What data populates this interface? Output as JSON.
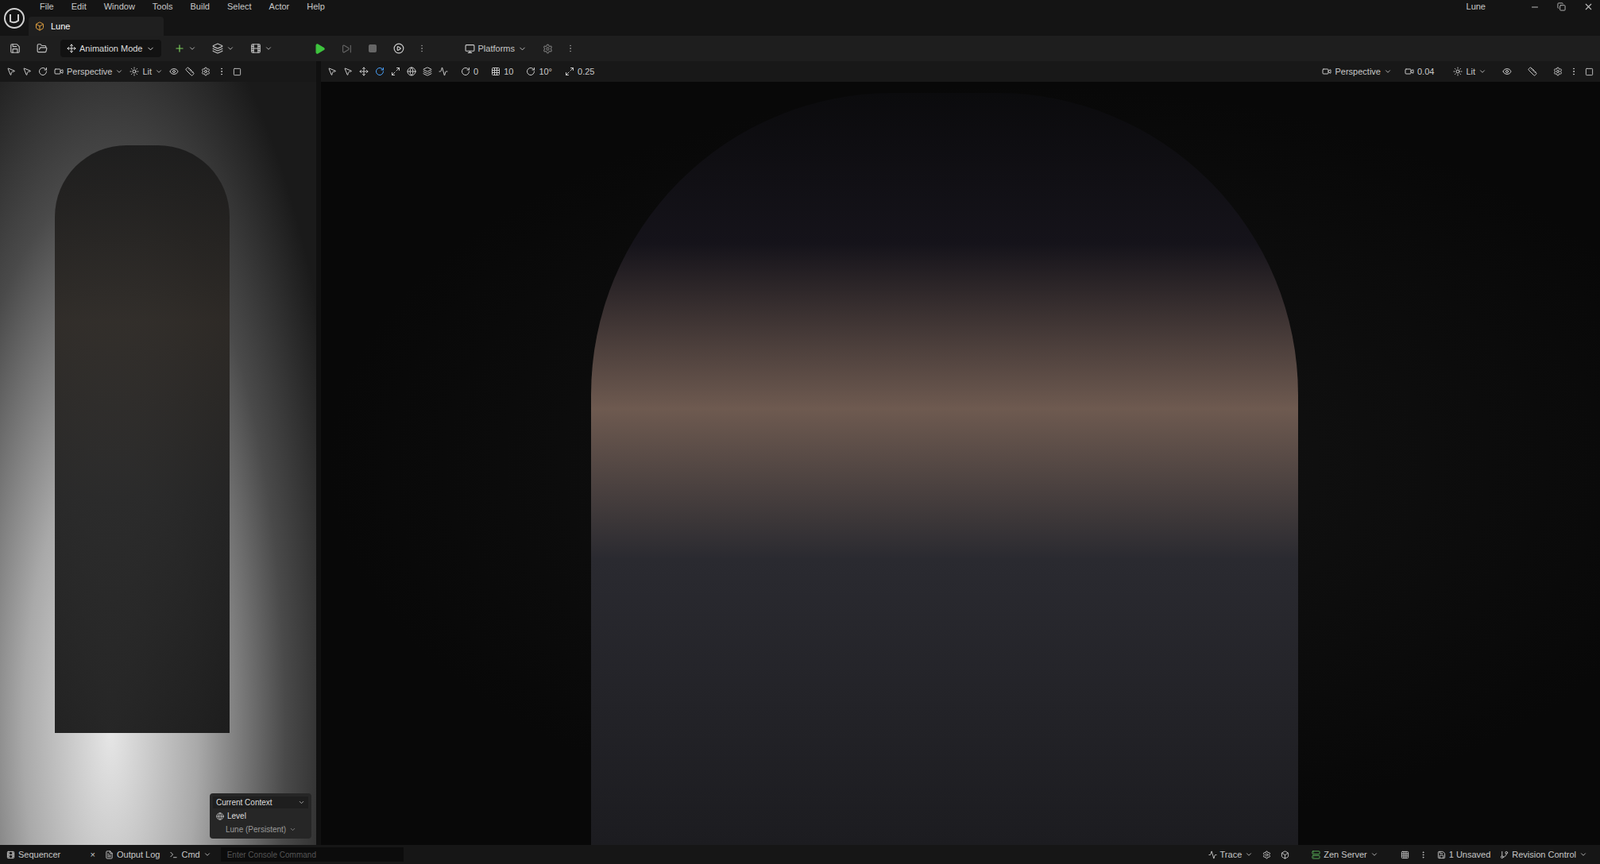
{
  "window": {
    "title": "Lune"
  },
  "menu": [
    "File",
    "Edit",
    "Window",
    "Tools",
    "Build",
    "Select",
    "Actor",
    "Help"
  ],
  "tabs": [
    {
      "label": "Lune",
      "selected": true
    }
  ],
  "toolbar": {
    "mode": "Animation Mode",
    "platforms": "Platforms"
  },
  "viewports": [
    {
      "camera": "Perspective",
      "view_mode": "Lit"
    },
    {
      "camera": "Perspective",
      "camera_speed": "0.04",
      "view_mode": "Lit",
      "snaps": [
        "0",
        "10",
        "10°",
        "0.25"
      ]
    }
  ],
  "context_panel": {
    "title": "Current Context",
    "type": "Level",
    "value": "Lune (Persistent)"
  },
  "status_bar": {
    "sequencer": "Sequencer",
    "close": "×",
    "output_log": "Output Log",
    "cmd": "Cmd",
    "console_placeholder": "Enter Console Command",
    "trace": "Trace",
    "zen": "Zen Server",
    "unsaved": "1 Unsaved",
    "revision": "Revision Control"
  }
}
